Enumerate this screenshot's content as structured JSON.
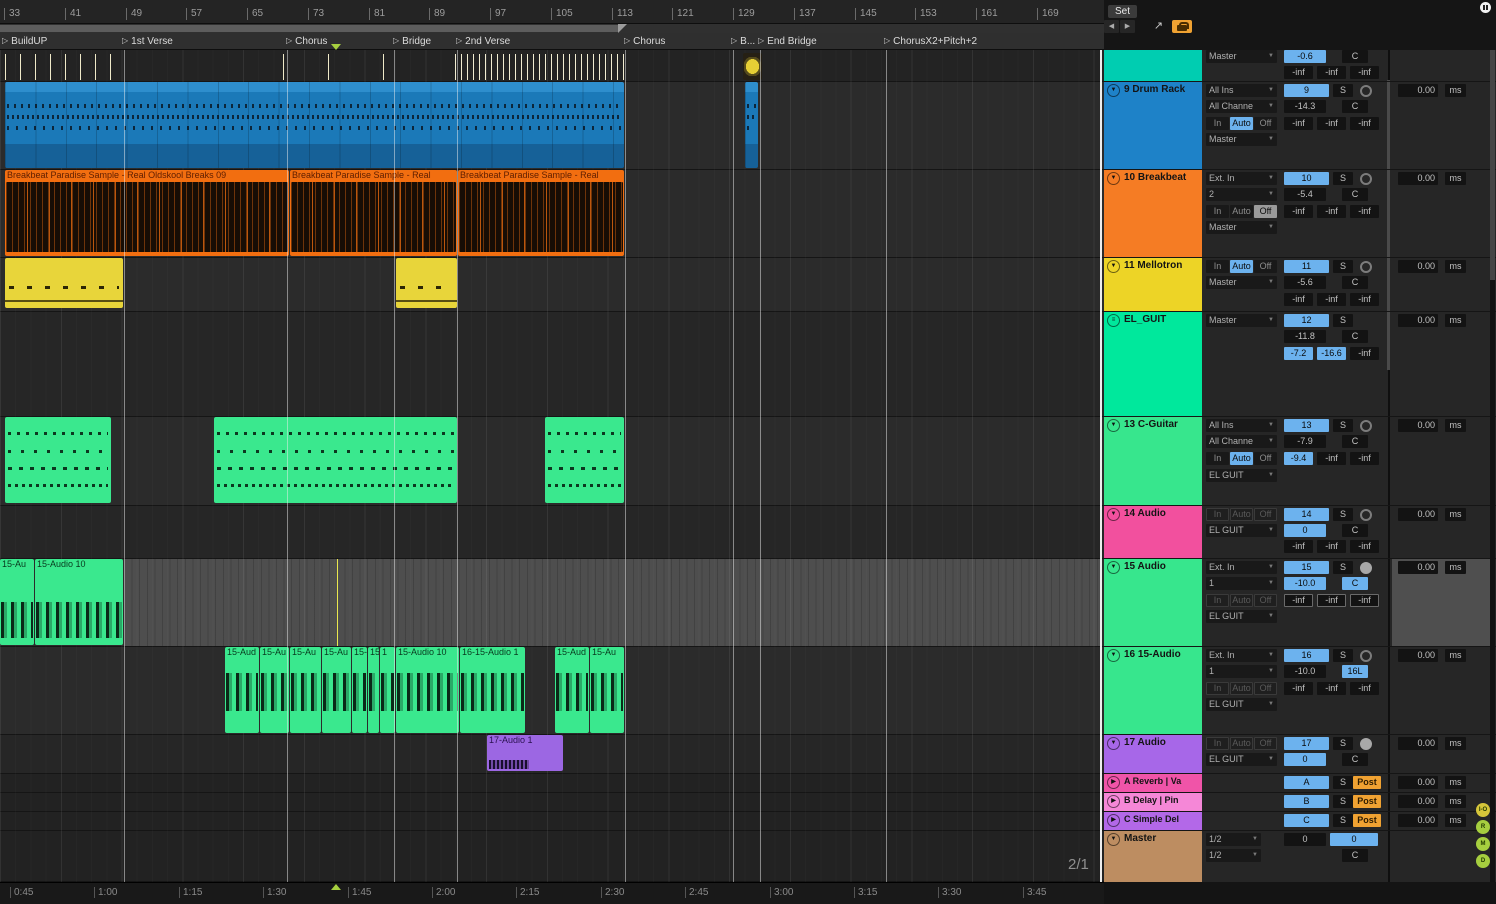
{
  "chrome": {
    "set_button": "Set",
    "signature": "2/1",
    "side_toggles": [
      "I-O",
      "R",
      "M",
      "D"
    ]
  },
  "labels": {
    "in": "In",
    "auto": "Auto",
    "off": "Off",
    "solo": "S",
    "post": "Post",
    "ms": "ms"
  },
  "bar_ruler": [
    "33",
    "41",
    "49",
    "57",
    "65",
    "73",
    "81",
    "89",
    "97",
    "105",
    "113",
    "121",
    "129",
    "137",
    "145",
    "153",
    "161",
    "169"
  ],
  "time_ruler": [
    "0:45",
    "1:00",
    "1:15",
    "1:30",
    "1:45",
    "2:00",
    "2:15",
    "2:30",
    "2:45",
    "3:00",
    "3:15",
    "3:30",
    "3:45"
  ],
  "locators": [
    "BuildUP",
    "1st Verse",
    "Chorus",
    "Bridge",
    "2nd Verse",
    "Chorus",
    "B...",
    "End Bridge",
    "ChorusX2+Pitch+2"
  ],
  "clips": {
    "breakbeat": [
      "Breakbeat Paradise Sample - Real Oldskool Breaks 09",
      "Breakbeat Paradise Sample - Real",
      "Breakbeat Paradise Sample - Real"
    ],
    "a15": [
      "15-Au",
      "15-Audio 10"
    ],
    "a16": [
      "15-Aud",
      "15-Au",
      "15-Au",
      "15-Au",
      "15-A",
      "15",
      "1",
      "15-Audio 10",
      "16-15-Audio 1",
      "15-Aud",
      "15-Au"
    ],
    "a17": "17-Audio 1"
  },
  "tracks": {
    "t8": {
      "out": "Master",
      "vol": "-0.6",
      "pan": "C",
      "s0": "-inf",
      "s1": "-inf",
      "s2": "-inf"
    },
    "t9": {
      "name": "9 Drum Rack",
      "num": "9",
      "in": "All Ins",
      "ch": "All Channe",
      "out": "Master",
      "vol": "-14.3",
      "pan": "C",
      "s0": "-inf",
      "s1": "-inf",
      "s2": "-inf",
      "delay": "0.00"
    },
    "t10": {
      "name": "10 Breakbeat",
      "num": "10",
      "in": "Ext. In",
      "ch": "2",
      "out": "Master",
      "vol": "-5.4",
      "pan": "C",
      "s0": "-inf",
      "s1": "-inf",
      "s2": "-inf",
      "delay": "0.00"
    },
    "t11": {
      "name": "11 Mellotron",
      "num": "11",
      "out": "Master",
      "vol": "-5.6",
      "pan": "C",
      "s0": "-inf",
      "s1": "-inf",
      "s2": "-inf",
      "delay": "0.00"
    },
    "t12": {
      "name": "EL_GUIT",
      "num": "12",
      "out": "Master",
      "vol": "-11.8",
      "pan": "C",
      "s0": "-7.2",
      "s1": "-16.6",
      "s2": "-inf",
      "delay": "0.00"
    },
    "t13": {
      "name": "13 C-Guitar",
      "num": "13",
      "in": "All Ins",
      "ch": "All Channe",
      "out": "EL GUIT",
      "vol": "-7.9",
      "pan": "C",
      "s0": "-9.4",
      "s1": "-inf",
      "s2": "-inf",
      "delay": "0.00"
    },
    "t14": {
      "name": "14 Audio",
      "num": "14",
      "out": "EL GUIT",
      "vol": "0",
      "pan": "C",
      "s0": "-inf",
      "s1": "-inf",
      "s2": "-inf",
      "delay": "0.00"
    },
    "t15": {
      "name": "15 Audio",
      "num": "15",
      "in": "Ext. In",
      "ch": "1",
      "out": "EL GUIT",
      "vol": "-10.0",
      "pan": "C",
      "s0": "-inf",
      "s1": "-inf",
      "s2": "-inf",
      "delay": "0.00"
    },
    "t16": {
      "name": "16 15-Audio",
      "num": "16",
      "in": "Ext. In",
      "ch": "1",
      "out": "EL GUIT",
      "vol": "-10.0",
      "pan": "16L",
      "s0": "-inf",
      "s1": "-inf",
      "s2": "-inf",
      "delay": "0.00"
    },
    "t17": {
      "name": "17 Audio",
      "num": "17",
      "out": "EL GUIT",
      "vol": "0",
      "pan": "C",
      "delay": "0.00"
    },
    "ra": {
      "name": "A Reverb | Va",
      "num": "A",
      "delay": "0.00"
    },
    "rb": {
      "name": "B Delay | Pin",
      "num": "B",
      "delay": "0.00"
    },
    "rc": {
      "name": "C Simple Del",
      "num": "C",
      "delay": "0.00"
    },
    "master": {
      "name": "Master",
      "out1": "1/2",
      "out2": "1/2",
      "vol": "0",
      "cue": "0",
      "pan": "C"
    }
  },
  "colors": {
    "selection_blue": "#6cb2ee",
    "post_orange": "#f0a232",
    "track_colors": {
      "t8": "#00cdb1",
      "t9": "#1e82c8",
      "t10": "#f57c24",
      "t11": "#edd426",
      "t12": "#00e89c",
      "t13": "#37e68d",
      "t14": "#f2509e",
      "t15": "#37e68d",
      "t16": "#37e68d",
      "t17": "#a767e8",
      "ra": "#f054a8",
      "rb": "#f587d7",
      "rc": "#b368e8",
      "master": "#bd8d61"
    },
    "clip_blue": "#1b79b8",
    "clip_orange": "#f26e10",
    "clip_yellow": "#e8d53a",
    "clip_green": "#3ae88e",
    "clip_purple": "#9c67e3"
  }
}
